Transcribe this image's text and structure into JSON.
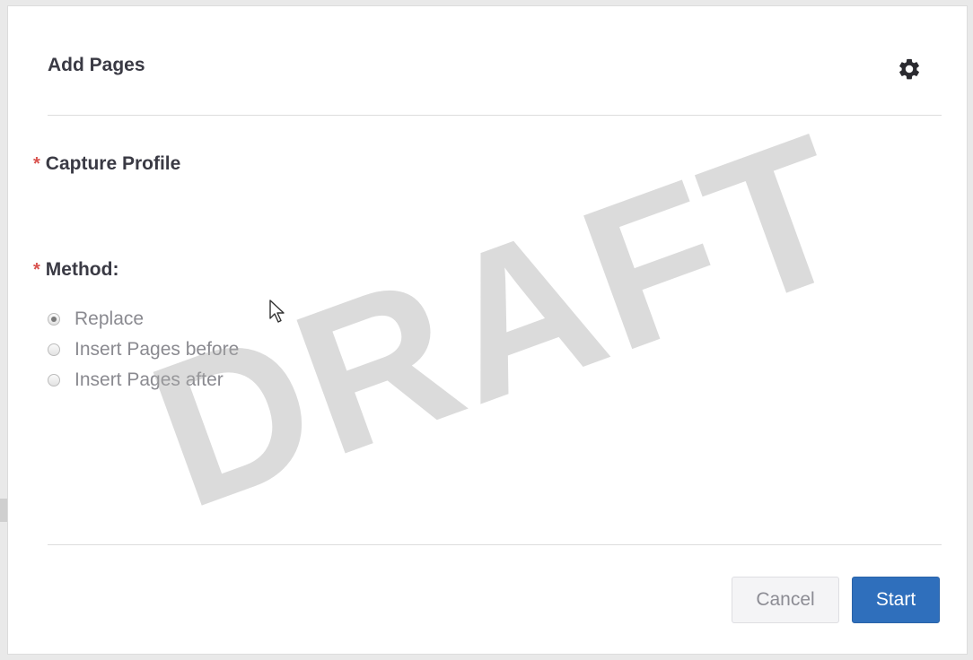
{
  "dialog": {
    "title": "Add Pages",
    "settings_icon": "gear-icon"
  },
  "form": {
    "required_marker": "*",
    "capture_profile_label": "Capture Profile",
    "method_label": "Method:",
    "method_options": [
      {
        "label": "Replace",
        "selected": true
      },
      {
        "label": "Insert Pages before",
        "selected": false
      },
      {
        "label": "Insert Pages after",
        "selected": false
      }
    ]
  },
  "watermark": {
    "text": "DRAFT"
  },
  "footer": {
    "cancel_label": "Cancel",
    "start_label": "Start"
  },
  "colors": {
    "required": "#d9534f",
    "primary_button": "#2f6fbc",
    "title_text": "#3a3a44"
  }
}
